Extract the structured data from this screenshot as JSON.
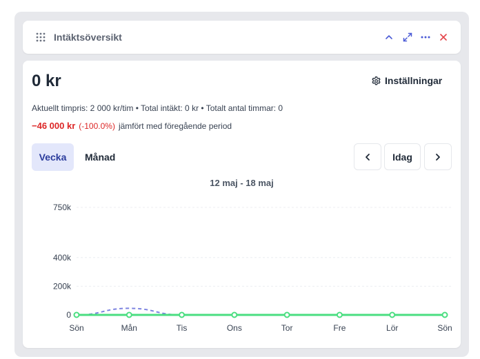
{
  "header": {
    "title": "Intäktsöversikt",
    "icons": [
      "grip-icon",
      "chevron-up-icon",
      "expand-icon",
      "more-icon",
      "close-icon"
    ],
    "close_color": "#e5484d",
    "icon_color": "#4b5bd6"
  },
  "summary": {
    "amount": "0 kr",
    "settings_label": "Inställningar",
    "info": "Aktuellt timpris: 2 000 kr/tim • Total intäkt: 0 kr • Totalt antal timmar: 0",
    "change_amount": "−46 000 kr",
    "change_pct": "(-100.0%)",
    "change_text": "jämfört med föregående period"
  },
  "tabs": [
    {
      "label": "Vecka",
      "active": true
    },
    {
      "label": "Månad",
      "active": false
    }
  ],
  "nav": {
    "prev_icon": "chevron-left-icon",
    "today_label": "Idag",
    "next_icon": "chevron-right-icon"
  },
  "period": "12 maj - 18 maj",
  "chart_data": {
    "type": "line",
    "categories": [
      "Sön",
      "Mån",
      "Tis",
      "Ons",
      "Tor",
      "Fre",
      "Lör",
      "Sön"
    ],
    "y_ticks": [
      0,
      200000,
      400000,
      750000
    ],
    "y_tick_labels": [
      "0",
      "200k",
      "400k",
      "750k"
    ],
    "ylim": [
      0,
      750000
    ],
    "grid": true,
    "series": [
      {
        "values": [
          0,
          0,
          0,
          0,
          0,
          0,
          0,
          0
        ],
        "color": "#4ade80",
        "style": "solid"
      },
      {
        "values": [
          0,
          46000,
          0,
          0,
          0,
          0,
          0,
          0
        ],
        "color": "#7c83e0",
        "style": "dashed"
      }
    ]
  }
}
